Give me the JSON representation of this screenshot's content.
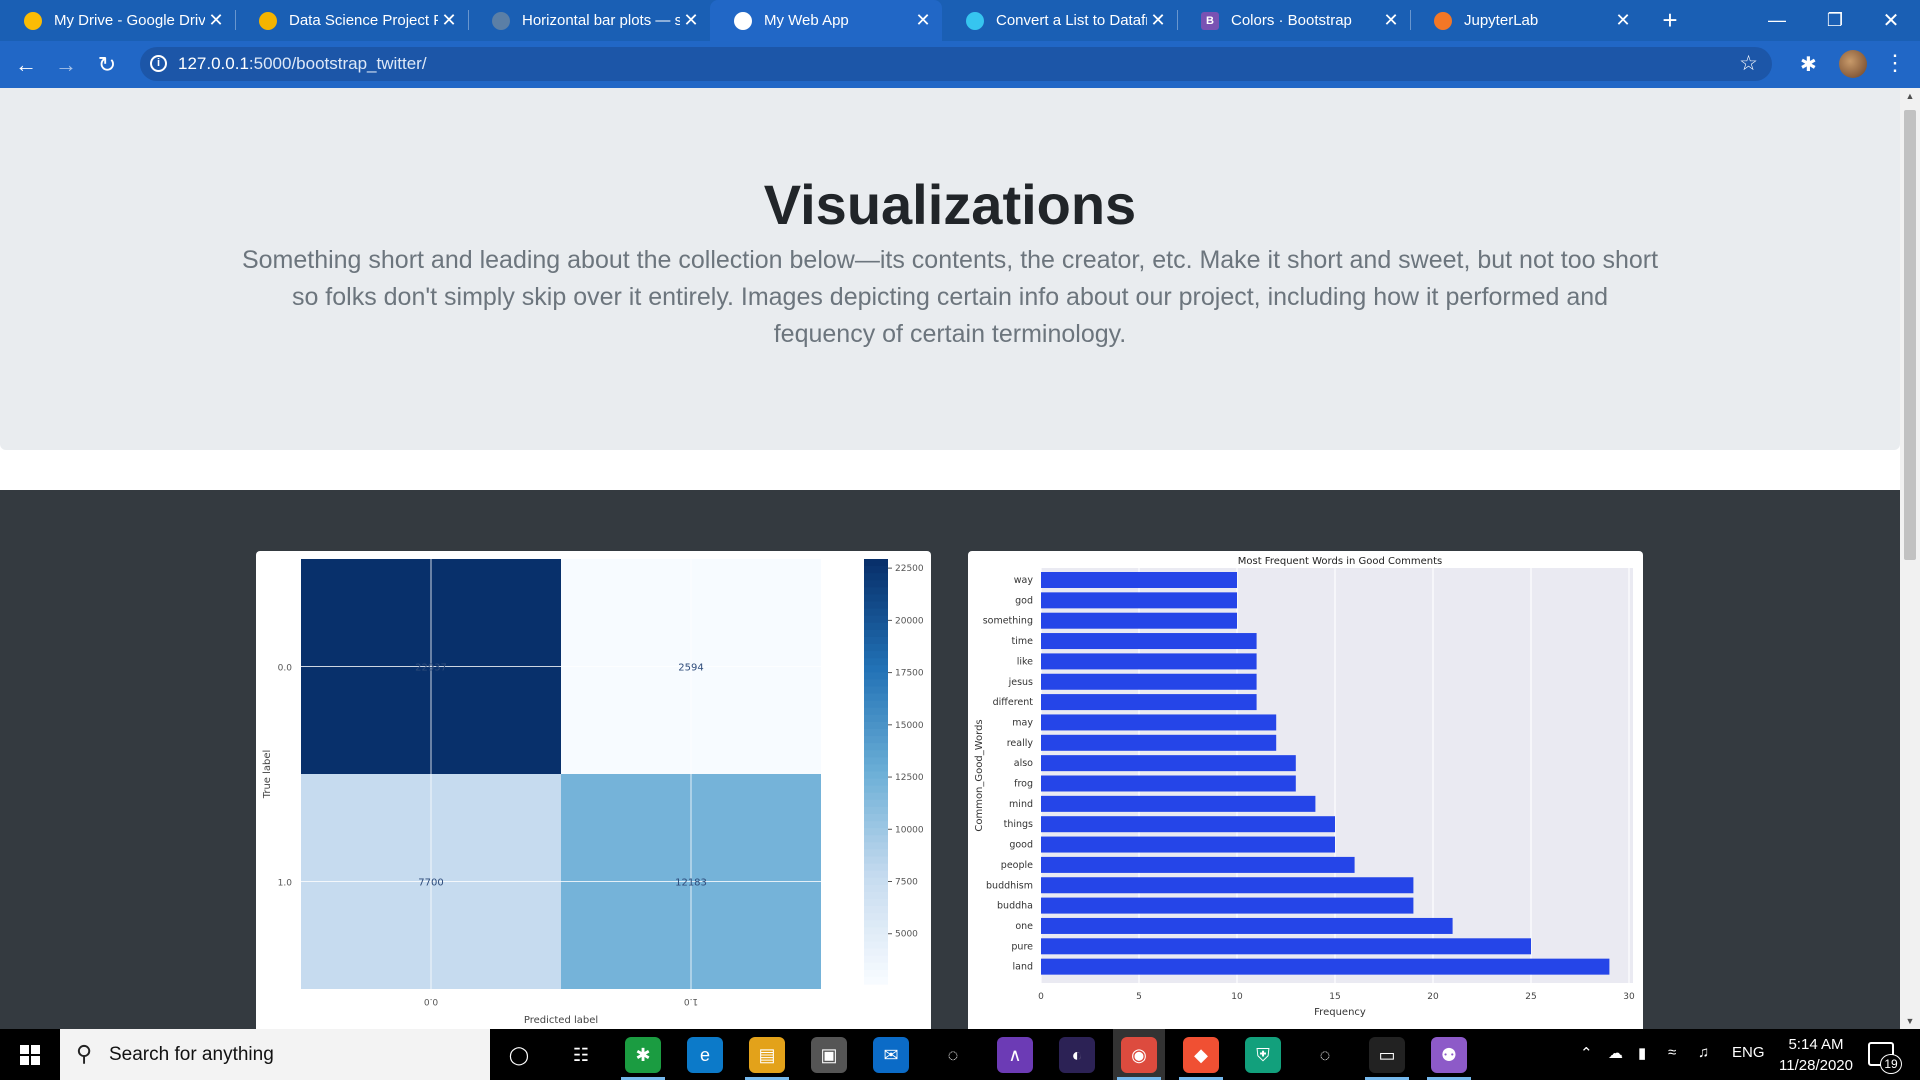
{
  "browser": {
    "tabs": [
      {
        "label": "My Drive - Google Drive",
        "icon": "google-drive-icon",
        "color": "#fbbc04"
      },
      {
        "label": "Data Science Project Pitch",
        "icon": "google-slides-icon",
        "color": "#f4b400"
      },
      {
        "label": "Horizontal bar plots — seaborn",
        "icon": "seaborn-icon",
        "color": "#5b7fa6"
      },
      {
        "label": "My Web App",
        "icon": "globe-icon",
        "color": "#ffffff",
        "active": true
      },
      {
        "label": "Convert a List to Dataframe",
        "icon": "datacamp-icon",
        "color": "#36c5f0"
      },
      {
        "label": "Colors · Bootstrap",
        "icon": "bootstrap-icon",
        "color": "#ffffff",
        "glyph": "B"
      },
      {
        "label": "JupyterLab",
        "icon": "jupyter-icon",
        "color": "#f37726"
      }
    ],
    "url_host": "127.0.0.1",
    "url_path": ":5000/bootstrap_twitter/"
  },
  "page": {
    "heading": "Visualizations",
    "lead": "Something short and leading about the collection below—its contents, the creator, etc. Make it short and sweet, but not too short so folks don't simply skip over it entirely. Images depicting certain info about our project, including how it performed and fequency of certain terminology."
  },
  "chart_data": [
    {
      "type": "heatmap",
      "title": "",
      "xlabel": "Predicted label",
      "ylabel": "True label",
      "x_categories": [
        "0.0",
        "1.0"
      ],
      "y_categories": [
        "0.0",
        "1.0"
      ],
      "values": [
        [
          22937,
          2594
        ],
        [
          7700,
          12183
        ]
      ],
      "cell_labels": [
        "22937",
        "2594",
        "7700",
        "12183"
      ],
      "colorbar_ticks": [
        "22500",
        "20000",
        "17500",
        "15000",
        "12500",
        "10000",
        "7500",
        "5000"
      ],
      "colormap": "Blues",
      "grid": true
    },
    {
      "type": "bar",
      "orientation": "horizontal",
      "title": "Most Frequent Words in Good Comments",
      "xlabel": "Frequency",
      "ylabel": "Common_Good_Words",
      "categories": [
        "way",
        "god",
        "something",
        "time",
        "like",
        "jesus",
        "different",
        "may",
        "really",
        "also",
        "frog",
        "mind",
        "things",
        "good",
        "people",
        "buddhism",
        "buddha",
        "one",
        "pure",
        "land"
      ],
      "values": [
        10,
        10,
        10,
        11,
        11,
        11,
        11,
        12,
        12,
        13,
        13,
        14,
        15,
        15,
        16,
        19,
        19,
        21,
        25,
        29
      ],
      "x_ticks": [
        "0",
        "5",
        "10",
        "15",
        "20",
        "25",
        "30"
      ],
      "xlim": [
        0,
        30
      ],
      "bar_color": "#2545e8",
      "background": "#eaeaf2",
      "grid": true
    }
  ],
  "taskbar": {
    "search_placeholder": "Search for anything",
    "language": "ENG",
    "time": "5:14 AM",
    "date": "11/28/2020",
    "notification_count": "19"
  }
}
